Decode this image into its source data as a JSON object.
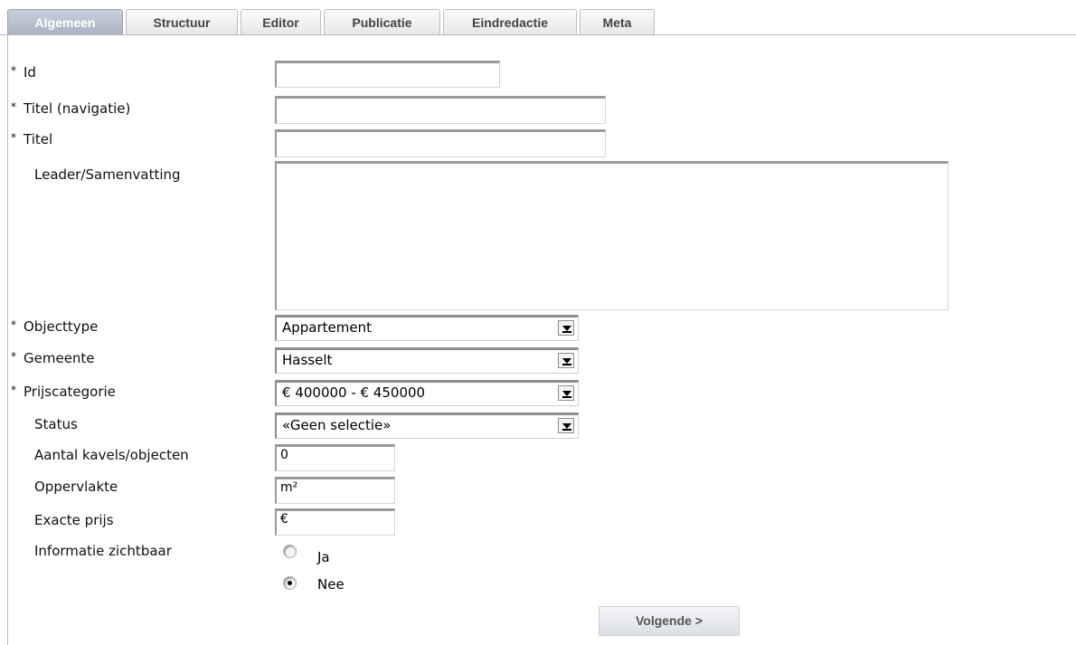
{
  "tabs": [
    {
      "label": "Algemeen",
      "active": true
    },
    {
      "label": "Structuur"
    },
    {
      "label": "Editor"
    },
    {
      "label": "Publicatie"
    },
    {
      "label": "Eindredactie"
    },
    {
      "label": "Meta"
    }
  ],
  "required_marker": "*",
  "form": {
    "id": {
      "label": "Id",
      "required": true,
      "value": ""
    },
    "titel_nav": {
      "label": "Titel (navigatie)",
      "required": true,
      "value": ""
    },
    "titel": {
      "label": "Titel",
      "required": true,
      "value": ""
    },
    "leader": {
      "label": "Leader/Samenvatting",
      "required": false,
      "value": ""
    },
    "objecttype": {
      "label": "Objecttype",
      "required": true,
      "value": "Appartement"
    },
    "gemeente": {
      "label": "Gemeente",
      "required": true,
      "value": "Hasselt"
    },
    "prijscategorie": {
      "label": "Prijscategorie",
      "required": true,
      "value": "€ 400000 - € 450000"
    },
    "status": {
      "label": "Status",
      "required": false,
      "value": "«Geen selectie»"
    },
    "kavels": {
      "label": "Aantal kavels/objecten",
      "required": false,
      "value": "0"
    },
    "oppervlakte": {
      "label": "Oppervlakte",
      "required": false,
      "value": "m²"
    },
    "exacte_prijs": {
      "label": "Exacte prijs",
      "required": false,
      "value": "€"
    },
    "informatie": {
      "label": "Informatie zichtbaar",
      "options": [
        {
          "label": "Ja",
          "checked": false
        },
        {
          "label": "Nee",
          "checked": true
        }
      ]
    }
  },
  "buttons": {
    "next": "Volgende >"
  }
}
